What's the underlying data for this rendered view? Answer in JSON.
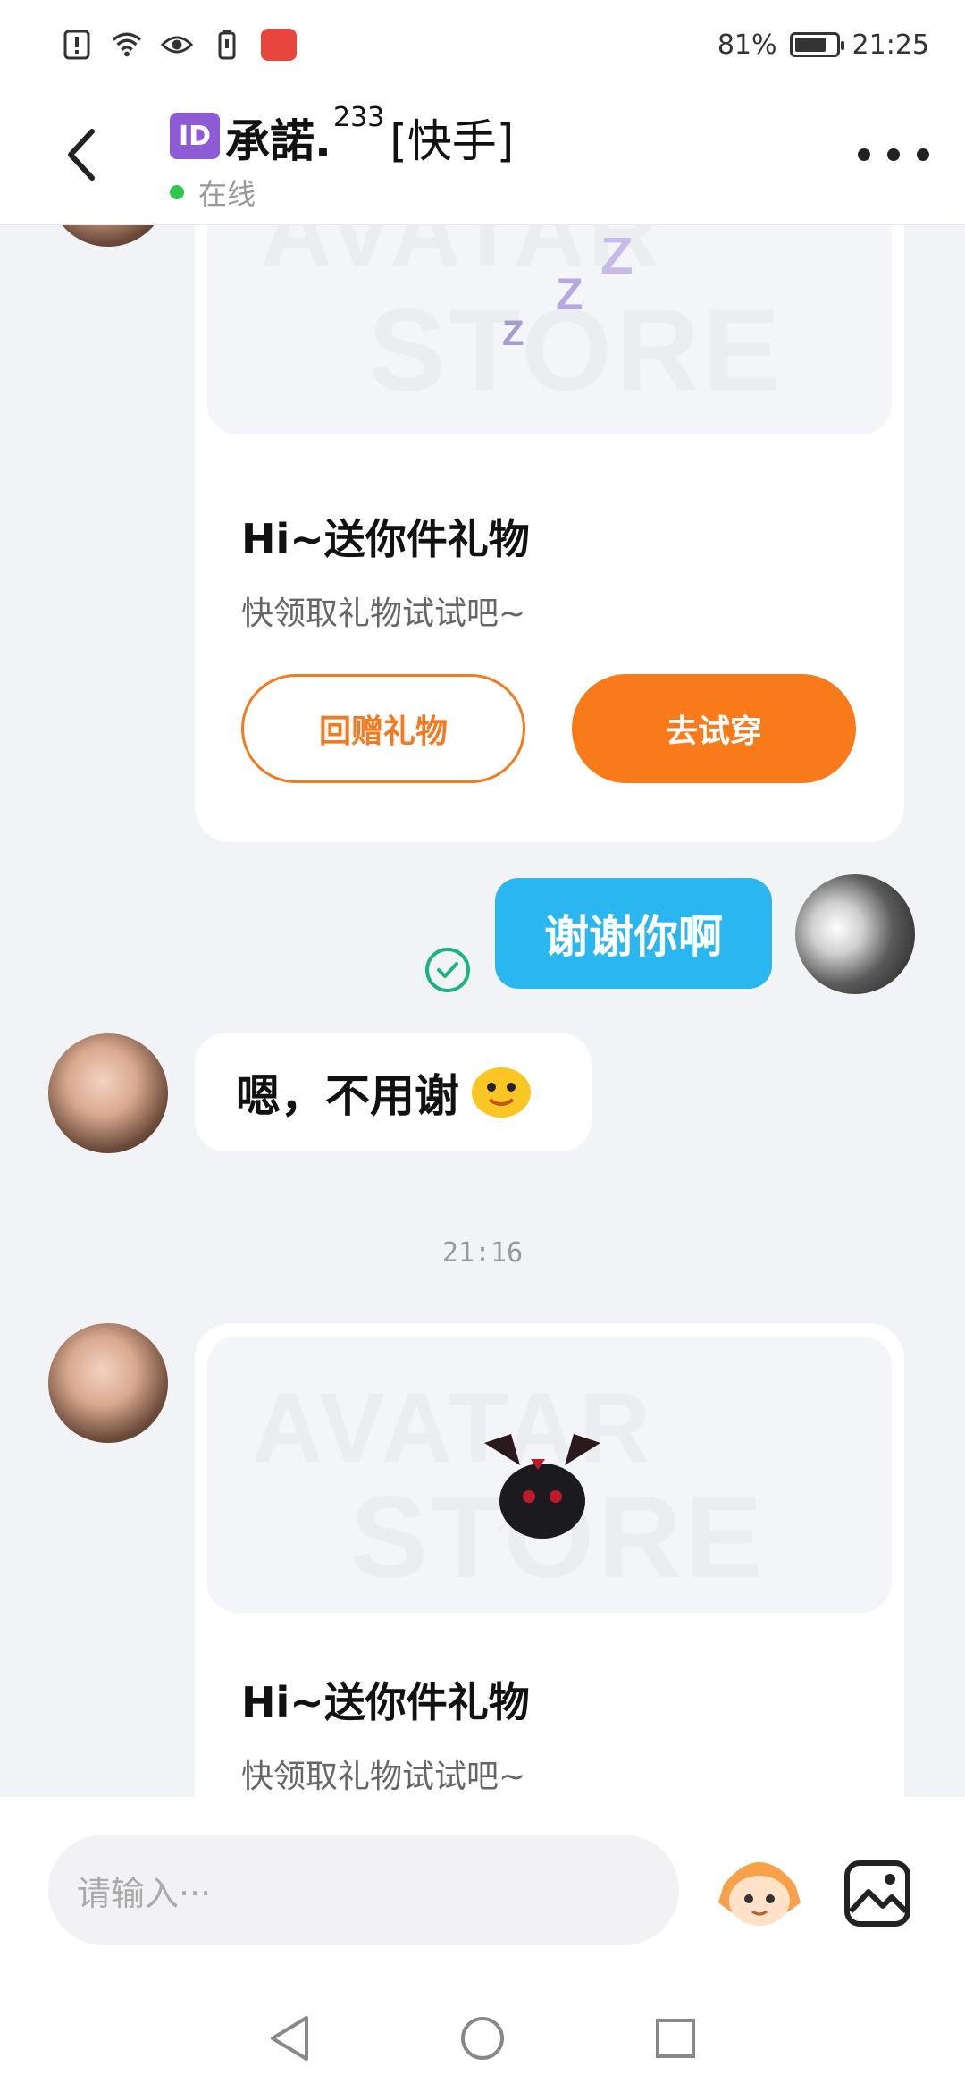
{
  "status_bar": {
    "battery_percent": "81%",
    "time": "21:25",
    "battery_level": 0.81
  },
  "header": {
    "id_badge": "ID",
    "name": "承諾.",
    "superscript": "233",
    "tag": "[快手]",
    "status": "在线"
  },
  "chat": {
    "gift_card_1": {
      "title": "Hi~送你件礼物",
      "subtitle": "快领取礼物试试吧~",
      "watermark_1": "AVATAR",
      "watermark_2": "STORE",
      "button_return": "回赠礼物",
      "button_try": "去试穿"
    },
    "my_message": "谢谢你啊",
    "their_message": "嗯，不用谢",
    "time_divider": "21:16",
    "gift_card_2": {
      "title": "Hi~送你件礼物",
      "subtitle": "快领取礼物试试吧~",
      "watermark_1": "AVATAR",
      "watermark_2": "STORE"
    }
  },
  "input": {
    "placeholder": "请输入···"
  },
  "colors": {
    "accent_orange": "#f97a1a",
    "bubble_blue": "#2ab7ef",
    "online_green": "#2dc84d"
  },
  "icons": [
    "back-arrow-icon",
    "more-icon",
    "check-icon",
    "sticker-icon",
    "image-icon",
    "nav-back-icon",
    "nav-home-icon",
    "nav-recent-icon"
  ]
}
